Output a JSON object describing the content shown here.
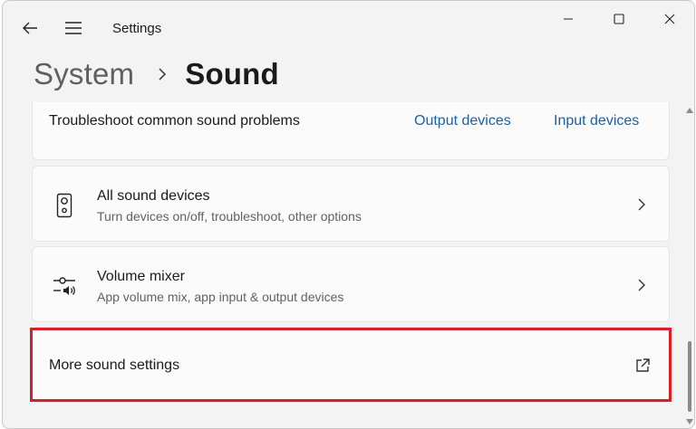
{
  "window": {
    "app_title": "Settings",
    "controls": {
      "minimize": "minimize-icon",
      "maximize": "maximize-icon",
      "close": "close-icon"
    }
  },
  "header": {
    "parent": "System",
    "separator": "chevron-right-icon",
    "current": "Sound"
  },
  "troubleshoot": {
    "label": "Troubleshoot common sound problems",
    "links": [
      "Output devices",
      "Input devices"
    ]
  },
  "items": [
    {
      "title": "All sound devices",
      "description": "Turn devices on/off, troubleshoot, other options",
      "icon": "speaker-icon"
    },
    {
      "title": "Volume mixer",
      "description": "App volume mix, app input & output devices",
      "icon": "volume-mixer-icon"
    }
  ],
  "more_settings": {
    "label": "More sound settings",
    "icon": "external-link-icon"
  },
  "colors": {
    "accent_link": "#1c5fa8",
    "highlight": "#d62027",
    "background": "#f3f3f3",
    "card": "#fbfbfb"
  }
}
